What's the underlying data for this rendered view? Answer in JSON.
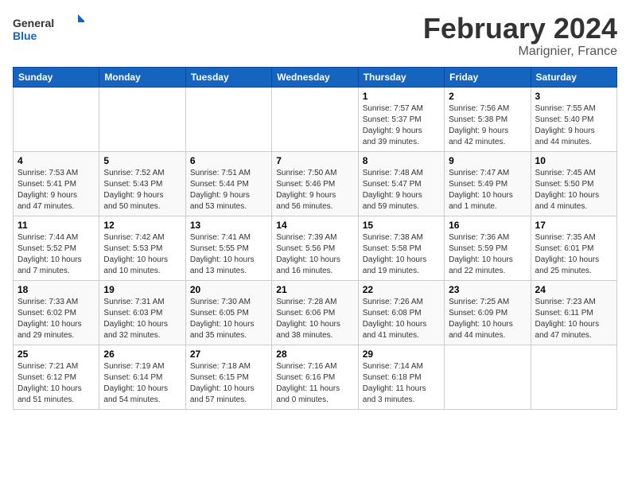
{
  "header": {
    "logo_general": "General",
    "logo_blue": "Blue",
    "title": "February 2024",
    "subtitle": "Marignier, France"
  },
  "days_of_week": [
    "Sunday",
    "Monday",
    "Tuesday",
    "Wednesday",
    "Thursday",
    "Friday",
    "Saturday"
  ],
  "weeks": [
    [
      {
        "day": "",
        "info": ""
      },
      {
        "day": "",
        "info": ""
      },
      {
        "day": "",
        "info": ""
      },
      {
        "day": "",
        "info": ""
      },
      {
        "day": "1",
        "info": "Sunrise: 7:57 AM\nSunset: 5:37 PM\nDaylight: 9 hours\nand 39 minutes."
      },
      {
        "day": "2",
        "info": "Sunrise: 7:56 AM\nSunset: 5:38 PM\nDaylight: 9 hours\nand 42 minutes."
      },
      {
        "day": "3",
        "info": "Sunrise: 7:55 AM\nSunset: 5:40 PM\nDaylight: 9 hours\nand 44 minutes."
      }
    ],
    [
      {
        "day": "4",
        "info": "Sunrise: 7:53 AM\nSunset: 5:41 PM\nDaylight: 9 hours\nand 47 minutes."
      },
      {
        "day": "5",
        "info": "Sunrise: 7:52 AM\nSunset: 5:43 PM\nDaylight: 9 hours\nand 50 minutes."
      },
      {
        "day": "6",
        "info": "Sunrise: 7:51 AM\nSunset: 5:44 PM\nDaylight: 9 hours\nand 53 minutes."
      },
      {
        "day": "7",
        "info": "Sunrise: 7:50 AM\nSunset: 5:46 PM\nDaylight: 9 hours\nand 56 minutes."
      },
      {
        "day": "8",
        "info": "Sunrise: 7:48 AM\nSunset: 5:47 PM\nDaylight: 9 hours\nand 59 minutes."
      },
      {
        "day": "9",
        "info": "Sunrise: 7:47 AM\nSunset: 5:49 PM\nDaylight: 10 hours\nand 1 minute."
      },
      {
        "day": "10",
        "info": "Sunrise: 7:45 AM\nSunset: 5:50 PM\nDaylight: 10 hours\nand 4 minutes."
      }
    ],
    [
      {
        "day": "11",
        "info": "Sunrise: 7:44 AM\nSunset: 5:52 PM\nDaylight: 10 hours\nand 7 minutes."
      },
      {
        "day": "12",
        "info": "Sunrise: 7:42 AM\nSunset: 5:53 PM\nDaylight: 10 hours\nand 10 minutes."
      },
      {
        "day": "13",
        "info": "Sunrise: 7:41 AM\nSunset: 5:55 PM\nDaylight: 10 hours\nand 13 minutes."
      },
      {
        "day": "14",
        "info": "Sunrise: 7:39 AM\nSunset: 5:56 PM\nDaylight: 10 hours\nand 16 minutes."
      },
      {
        "day": "15",
        "info": "Sunrise: 7:38 AM\nSunset: 5:58 PM\nDaylight: 10 hours\nand 19 minutes."
      },
      {
        "day": "16",
        "info": "Sunrise: 7:36 AM\nSunset: 5:59 PM\nDaylight: 10 hours\nand 22 minutes."
      },
      {
        "day": "17",
        "info": "Sunrise: 7:35 AM\nSunset: 6:01 PM\nDaylight: 10 hours\nand 25 minutes."
      }
    ],
    [
      {
        "day": "18",
        "info": "Sunrise: 7:33 AM\nSunset: 6:02 PM\nDaylight: 10 hours\nand 29 minutes."
      },
      {
        "day": "19",
        "info": "Sunrise: 7:31 AM\nSunset: 6:03 PM\nDaylight: 10 hours\nand 32 minutes."
      },
      {
        "day": "20",
        "info": "Sunrise: 7:30 AM\nSunset: 6:05 PM\nDaylight: 10 hours\nand 35 minutes."
      },
      {
        "day": "21",
        "info": "Sunrise: 7:28 AM\nSunset: 6:06 PM\nDaylight: 10 hours\nand 38 minutes."
      },
      {
        "day": "22",
        "info": "Sunrise: 7:26 AM\nSunset: 6:08 PM\nDaylight: 10 hours\nand 41 minutes."
      },
      {
        "day": "23",
        "info": "Sunrise: 7:25 AM\nSunset: 6:09 PM\nDaylight: 10 hours\nand 44 minutes."
      },
      {
        "day": "24",
        "info": "Sunrise: 7:23 AM\nSunset: 6:11 PM\nDaylight: 10 hours\nand 47 minutes."
      }
    ],
    [
      {
        "day": "25",
        "info": "Sunrise: 7:21 AM\nSunset: 6:12 PM\nDaylight: 10 hours\nand 51 minutes."
      },
      {
        "day": "26",
        "info": "Sunrise: 7:19 AM\nSunset: 6:14 PM\nDaylight: 10 hours\nand 54 minutes."
      },
      {
        "day": "27",
        "info": "Sunrise: 7:18 AM\nSunset: 6:15 PM\nDaylight: 10 hours\nand 57 minutes."
      },
      {
        "day": "28",
        "info": "Sunrise: 7:16 AM\nSunset: 6:16 PM\nDaylight: 11 hours\nand 0 minutes."
      },
      {
        "day": "29",
        "info": "Sunrise: 7:14 AM\nSunset: 6:18 PM\nDaylight: 11 hours\nand 3 minutes."
      },
      {
        "day": "",
        "info": ""
      },
      {
        "day": "",
        "info": ""
      }
    ]
  ]
}
